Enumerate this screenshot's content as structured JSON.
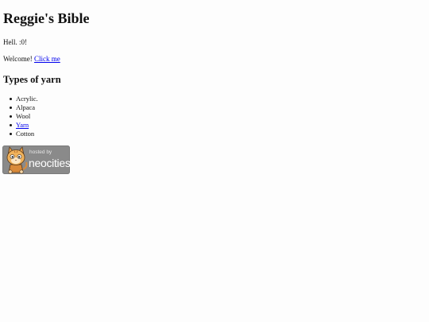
{
  "header": {
    "title": "Reggie's Bible"
  },
  "intro": {
    "greeting": "Hell. :0!",
    "welcome_prefix": "Welcome! ",
    "welcome_link": "Click me"
  },
  "yarn": {
    "heading": "Types of yarn",
    "items": [
      {
        "label": "Acrylic.",
        "is_link": false
      },
      {
        "label": "Alpaca",
        "is_link": false
      },
      {
        "label": "Wool",
        "is_link": false
      },
      {
        "label": "Yarn",
        "is_link": true
      },
      {
        "label": "Cotton",
        "is_link": false
      }
    ]
  },
  "badge": {
    "line1": "hosted by",
    "line2": "neocities",
    "icon": "neocities-cat-icon"
  },
  "colors": {
    "link": "#0000ee",
    "badge_background": "#8a8a8a",
    "page_background": "#fdfdfd"
  }
}
